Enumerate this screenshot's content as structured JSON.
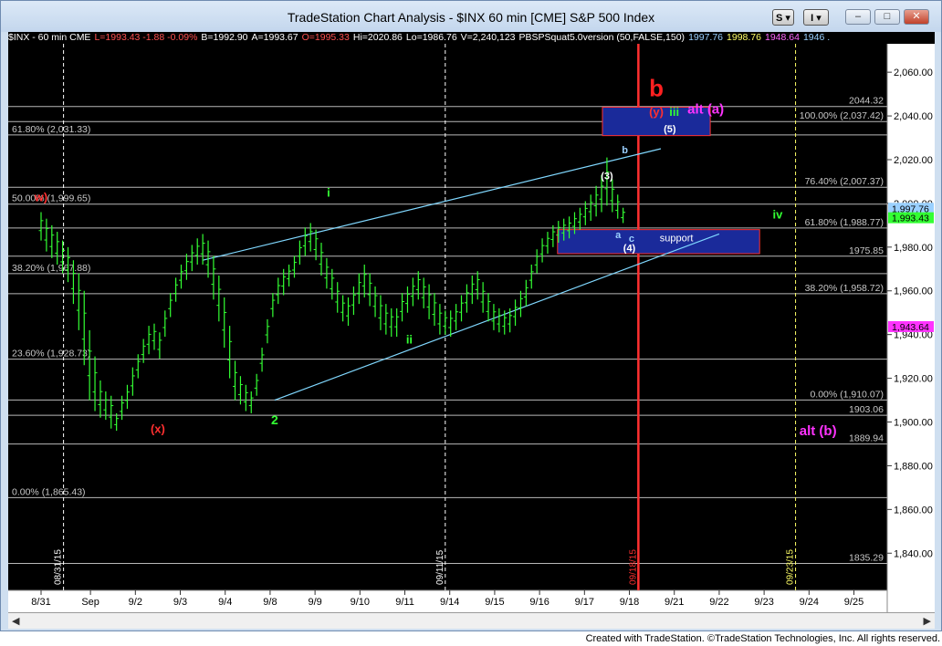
{
  "window": {
    "title": "TradeStation Chart Analysis - $INX 60 min [CME] S&P 500 Index",
    "btn_s": "S",
    "btn_i": "I",
    "min": "–",
    "max": "□",
    "close": "✕"
  },
  "infobar": [
    {
      "text": "$INX - 60 min  CME",
      "color": "#ffffff"
    },
    {
      "text": "L=1993.43  -1.88  -0.09%",
      "color": "#ff5050"
    },
    {
      "text": "B=1992.90",
      "color": "#ffffff"
    },
    {
      "text": "A=1993.67",
      "color": "#ffffff"
    },
    {
      "text": "O=1995.33",
      "color": "#ff5050"
    },
    {
      "text": "Hi=2020.86",
      "color": "#ffffff"
    },
    {
      "text": "Lo=1986.76",
      "color": "#ffffff"
    },
    {
      "text": "V=2,240,123",
      "color": "#ffffff"
    },
    {
      "text": "PBSPSquat5.0version (50,FALSE,150)",
      "color": "#ffffff"
    },
    {
      "text": "1997.76",
      "color": "#9ad0ff"
    },
    {
      "text": "1998.76",
      "color": "#ffff66"
    },
    {
      "text": "1948.64",
      "color": "#ff66ff"
    },
    {
      "text": "1946 .",
      "color": "#9ad0ff"
    }
  ],
  "footer": "Created with TradeStation. ©TradeStation Technologies, Inc. All rights reserved.",
  "colors": {
    "background": "#000000",
    "bars": "#33ff33",
    "trendline": "#80d8ff",
    "fib": "#b8b8b8",
    "box": "#1a2a9a",
    "box_border": "#ff3030",
    "marker": "#ff2020"
  },
  "chart_data": {
    "type": "ohlc-bar",
    "title": "$INX 60 min [CME] S&P 500 Index",
    "ylim": [
      1823,
      2073
    ],
    "price_ticks": [
      "2,060.00",
      "2,040.00",
      "2,020.00",
      "2,000.00",
      "1,980.00",
      "1,960.00",
      "1,940.00",
      "1,920.00",
      "1,900.00",
      "1,880.00",
      "1,860.00",
      "1,840.00"
    ],
    "price_tick_values": [
      2060,
      2040,
      2020,
      2000,
      1980,
      1960,
      1940,
      1920,
      1900,
      1880,
      1860,
      1840
    ],
    "x_ticks": [
      {
        "label": "8/31",
        "i": 0
      },
      {
        "label": "Sep",
        "i": 11
      },
      {
        "label": "9/2",
        "i": 21
      },
      {
        "label": "9/3",
        "i": 31
      },
      {
        "label": "9/4",
        "i": 41
      },
      {
        "label": "9/8",
        "i": 51
      },
      {
        "label": "9/9",
        "i": 61
      },
      {
        "label": "9/10",
        "i": 71
      },
      {
        "label": "9/11",
        "i": 81
      },
      {
        "label": "9/14",
        "i": 91
      },
      {
        "label": "9/15",
        "i": 101
      },
      {
        "label": "9/16",
        "i": 111
      },
      {
        "label": "9/17",
        "i": 121
      },
      {
        "label": "9/18",
        "i": 131
      },
      {
        "label": "9/21",
        "i": 141
      },
      {
        "label": "9/22",
        "i": 151
      },
      {
        "label": "9/23",
        "i": 161
      },
      {
        "label": "9/24",
        "i": 171
      },
      {
        "label": "9/25",
        "i": 181
      }
    ],
    "date_markers": [
      {
        "label": "08/31/15",
        "i": 5,
        "color": "#ffffff"
      },
      {
        "label": "09/11/15",
        "i": 90,
        "color": "#ffffff"
      },
      {
        "label": "09/18/15",
        "i": 133,
        "color": "#ff3030"
      },
      {
        "label": "09/23/15",
        "i": 168,
        "color": "#ffff66"
      }
    ],
    "horizontal_levels": [
      {
        "value": 2044.32,
        "label": "2044.32",
        "side": "right"
      },
      {
        "value": 2037.42,
        "label": "100.00% (2,037.42)",
        "side": "right"
      },
      {
        "value": 2031.33,
        "label": "61.80% (2,031.33)",
        "side": "left"
      },
      {
        "value": 2007.37,
        "label": "76.40% (2,007.37)",
        "side": "right"
      },
      {
        "value": 1999.65,
        "label": "50.00% (1,999.65)",
        "side": "left"
      },
      {
        "value": 1988.77,
        "label": "61.80% (1,988.77)",
        "side": "right"
      },
      {
        "value": 1975.85,
        "label": "1975.85",
        "side": "right"
      },
      {
        "value": 1967.88,
        "label": "38.20% (1,967.88)",
        "side": "left"
      },
      {
        "value": 1958.72,
        "label": "38.20% (1,958.72)",
        "side": "right"
      },
      {
        "value": 1928.73,
        "label": "23.60% (1,928.73)",
        "side": "left"
      },
      {
        "value": 1910.07,
        "label": "0.00% (1,910.07)",
        "side": "right"
      },
      {
        "value": 1903.06,
        "label": "1903.06",
        "side": "right"
      },
      {
        "value": 1889.94,
        "label": "1889.94",
        "side": "right"
      },
      {
        "value": 1865.43,
        "label": "0.00% (1,865.43)",
        "side": "left"
      },
      {
        "value": 1835.29,
        "label": "1835.29",
        "side": "right"
      }
    ],
    "right_axis_tags": [
      {
        "value": 1997.76,
        "label": "1,997.76",
        "bg": "#9ad0ff"
      },
      {
        "value": 1993.43,
        "label": "1,993.43",
        "bg": "#33ff33"
      },
      {
        "value": 1943.64,
        "label": "1,943.64",
        "bg": "#ff33ff"
      }
    ],
    "zones": [
      {
        "name": "target",
        "i0": 125,
        "i1": 149,
        "top": 2044,
        "bottom": 2031
      },
      {
        "name": "support",
        "i0": 115,
        "i1": 160,
        "top": 1988,
        "bottom": 1977,
        "label": "support"
      }
    ],
    "trendlines": [
      {
        "i0": 36,
        "v0": 1974,
        "i1": 138,
        "v1": 2025
      },
      {
        "i0": 52,
        "v0": 1910,
        "i1": 151,
        "v1": 1986
      }
    ],
    "wave_labels": [
      {
        "text": "i",
        "i": 64,
        "v": 2003,
        "color": "#33ff33",
        "size": 13
      },
      {
        "text": "ii",
        "i": 82,
        "v": 1936,
        "color": "#33ff33",
        "size": 13
      },
      {
        "text": "2",
        "i": 52,
        "v": 1899,
        "color": "#33ff33",
        "size": 14
      },
      {
        "text": "(x)",
        "i": 26,
        "v": 1895,
        "color": "#ff3030",
        "size": 13
      },
      {
        "text": "w)",
        "i": 0,
        "v": 2001,
        "color": "#ff3030",
        "size": 13
      },
      {
        "text": "b",
        "i": 137,
        "v": 2049,
        "color": "#ff2020",
        "size": 26
      },
      {
        "text": "(y)",
        "i": 137,
        "v": 2040,
        "color": "#ff3030",
        "size": 13
      },
      {
        "text": "iii",
        "i": 141,
        "v": 2040,
        "color": "#33ff33",
        "size": 13
      },
      {
        "text": "alt (a)",
        "i": 148,
        "v": 2041,
        "color": "#ff33ff",
        "size": 15
      },
      {
        "text": "(5)",
        "i": 140,
        "v": 2032.5,
        "color": "#ffffff",
        "size": 11
      },
      {
        "text": "b",
        "i": 130,
        "v": 2023,
        "color": "#9ad0ff",
        "size": 11
      },
      {
        "text": "(3)",
        "i": 126,
        "v": 2011,
        "color": "#ffffff",
        "size": 11
      },
      {
        "text": "a",
        "i": 128.5,
        "v": 1984,
        "color": "#9ad0ff",
        "size": 11
      },
      {
        "text": "c",
        "i": 131.5,
        "v": 1982.5,
        "color": "#9ad0ff",
        "size": 11
      },
      {
        "text": "(4)",
        "i": 131,
        "v": 1978,
        "color": "#ffffff",
        "size": 11
      },
      {
        "text": "iv",
        "i": 164,
        "v": 1993,
        "color": "#33ff33",
        "size": 13
      },
      {
        "text": "alt (b)",
        "i": 173,
        "v": 1894,
        "color": "#ff33ff",
        "size": 15
      }
    ],
    "bar_tops": [
      1996,
      1993,
      1990,
      1987,
      1983,
      1980,
      1974,
      1968,
      1960,
      1942,
      1930,
      1919,
      1914,
      1912,
      1904,
      1912,
      1917,
      1925,
      1931,
      1938,
      1944,
      1945,
      1941,
      1951,
      1959,
      1966,
      1972,
      1977,
      1981,
      1984,
      1986,
      1983,
      1976,
      1967,
      1957,
      1944,
      1928,
      1921,
      1917,
      1914,
      1922,
      1934,
      1947,
      1959,
      1966,
      1970,
      1972,
      1976,
      1983,
      1989,
      1991,
      1988,
      1982,
      1975,
      1970,
      1964,
      1958,
      1957,
      1962,
      1968,
      1972,
      1968,
      1962,
      1958,
      1954,
      1952,
      1952,
      1959,
      1962,
      1966,
      1969,
      1966,
      1963,
      1959,
      1954,
      1951,
      1951,
      1954,
      1958,
      1963,
      1967,
      1969,
      1964,
      1959,
      1954,
      1952,
      1951,
      1952,
      1956,
      1960,
      1965,
      1972,
      1979,
      1984,
      1987,
      1990,
      1992,
      1993,
      1994,
      1996,
      1998,
      2001,
      2004,
      2008,
      2013,
      2021,
      2011,
      2004,
      1998
    ],
    "bar_bottoms": [
      1983,
      1978,
      1975,
      1972,
      1968,
      1964,
      1954,
      1942,
      1926,
      1910,
      1905,
      1902,
      1901,
      1897,
      1896,
      1901,
      1906,
      1912,
      1920,
      1927,
      1931,
      1933,
      1929,
      1939,
      1948,
      1955,
      1961,
      1965,
      1969,
      1972,
      1972,
      1966,
      1956,
      1946,
      1934,
      1920,
      1910,
      1908,
      1905,
      1904,
      1912,
      1923,
      1936,
      1948,
      1954,
      1958,
      1962,
      1966,
      1972,
      1976,
      1978,
      1974,
      1967,
      1961,
      1956,
      1950,
      1946,
      1944,
      1949,
      1954,
      1957,
      1953,
      1948,
      1942,
      1940,
      1939,
      1939,
      1946,
      1950,
      1953,
      1956,
      1952,
      1947,
      1944,
      1940,
      1940,
      1939,
      1942,
      1946,
      1950,
      1954,
      1956,
      1950,
      1946,
      1942,
      1941,
      1940,
      1941,
      1944,
      1948,
      1953,
      1961,
      1968,
      1973,
      1977,
      1980,
      1982,
      1983,
      1984,
      1986,
      1988,
      1990,
      1992,
      1994,
      1996,
      1999,
      1996,
      1993,
      1991
    ],
    "bar_start_i": 0,
    "bar_step_i": 1.2,
    "x_axis_i_max": 199
  }
}
